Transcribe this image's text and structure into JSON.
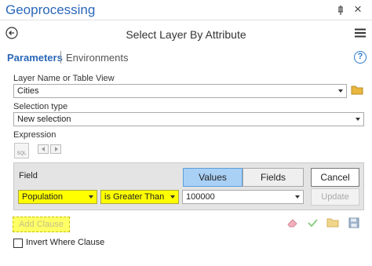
{
  "window": {
    "title": "Geoprocessing"
  },
  "tool": {
    "title": "Select Layer By Attribute"
  },
  "tabs": {
    "parameters": "Parameters",
    "environments": "Environments"
  },
  "help_label": "?",
  "params": {
    "layer_label": "Layer Name or Table View",
    "layer_value": "Cities",
    "selection_label": "Selection type",
    "selection_value": "New selection",
    "expression_label": "Expression",
    "sql_label": "SQL"
  },
  "expression": {
    "field_label": "Field",
    "values_tab": "Values",
    "fields_tab": "Fields",
    "cancel_label": "Cancel",
    "update_label": "Update",
    "field_value": "Population",
    "operator_value": "is Greater Than",
    "value_value": "100000"
  },
  "add_clause_label": "Add Clause",
  "invert_label": "Invert Where Clause",
  "icons": [
    "pin-icon",
    "close-icon",
    "back-icon",
    "menu-icon",
    "folder-icon",
    "eraser-icon",
    "check-icon",
    "open-folder-icon",
    "save-icon"
  ],
  "colors": {
    "accent": "#2a67b8",
    "highlight": "#ffff00",
    "values_tab": "#a9d0f5"
  }
}
